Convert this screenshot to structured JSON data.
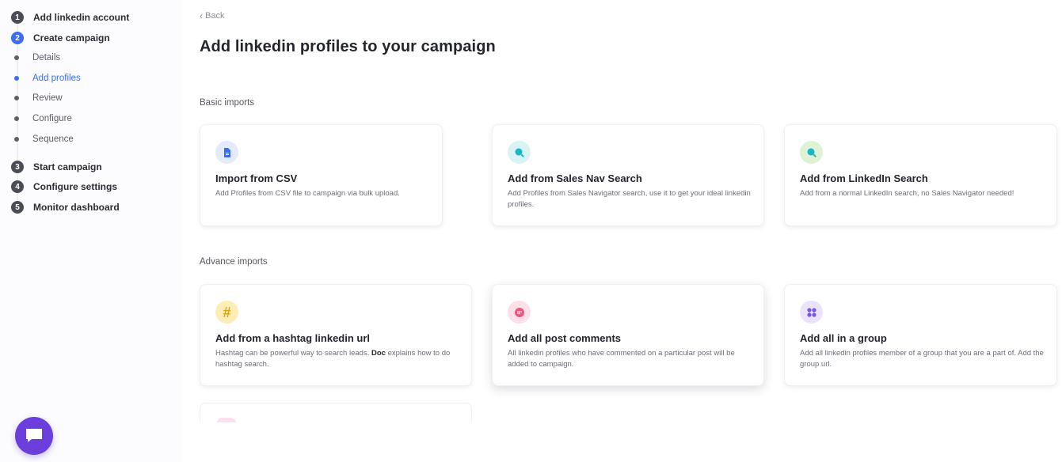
{
  "sidebar": {
    "steps": [
      {
        "number": "1",
        "label": "Add linkedin account"
      },
      {
        "number": "2",
        "label": "Create campaign"
      },
      {
        "number": "3",
        "label": "Start campaign"
      },
      {
        "number": "4",
        "label": "Configure settings"
      },
      {
        "number": "5",
        "label": "Monitor dashboard"
      }
    ],
    "substeps": [
      {
        "label": "Details"
      },
      {
        "label": "Add profiles"
      },
      {
        "label": "Review"
      },
      {
        "label": "Configure"
      },
      {
        "label": "Sequence"
      }
    ],
    "active_step": "2",
    "active_substep": "Add profiles"
  },
  "header": {
    "back_label": "Back",
    "title": "Add linkedin profiles to your campaign"
  },
  "basic": {
    "heading": "Basic imports",
    "cards": [
      {
        "icon": "csv-file-icon",
        "title": "Import from CSV",
        "desc": "Add Profiles from CSV file to campaign via bulk upload."
      },
      {
        "icon": "sales-nav-search-icon",
        "title": "Add from Sales Nav Search",
        "desc": "Add Profiles from Sales Navigator search, use it to get your ideal linkedin profiles."
      },
      {
        "icon": "linkedin-search-icon",
        "title": "Add from LinkedIn Search",
        "desc": "Add from a normal LinkedIn search, no Sales Navigator needed!"
      }
    ]
  },
  "advance": {
    "heading": "Advance imports",
    "cards": [
      {
        "icon": "hashtag-icon",
        "title": "Add from a hashtag linkedin url",
        "desc": "Hashtag can be powerful way to search leads.",
        "doc_link": "Doc",
        "desc_tail": "explains how to do hashtag search."
      },
      {
        "icon": "comment-icon",
        "title": "Add all post comments",
        "desc": "All linkedin profiles who have commented on a particular post will be added to campaign."
      },
      {
        "icon": "group-icon",
        "title": "Add all in a group",
        "desc": "Add all linkedin profiles member of a group that you are a part of. Add the group url."
      }
    ]
  },
  "colors": {
    "accent": "#3b6cf6",
    "chat_button": "#6c3fdc"
  },
  "chat": {
    "icon": "chat-icon"
  }
}
